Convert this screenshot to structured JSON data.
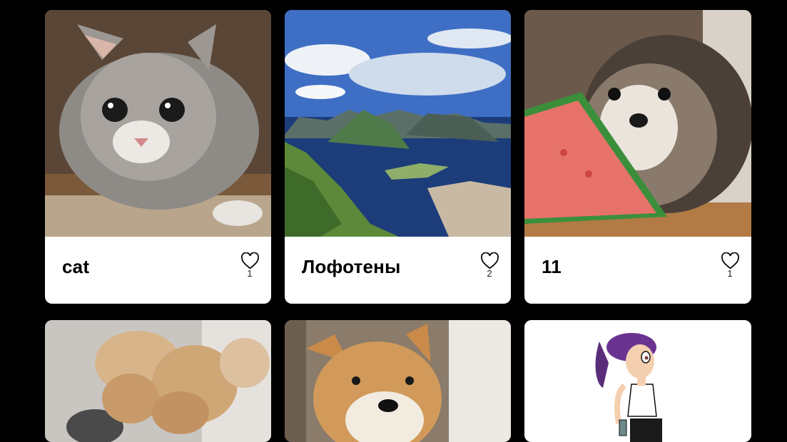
{
  "cards": [
    {
      "title": "cat",
      "likes": "1",
      "image": "cat-photo"
    },
    {
      "title": "Лофотены",
      "likes": "2",
      "image": "lofoten-landscape-photo"
    },
    {
      "title": "11",
      "likes": "1",
      "image": "hedgehog-watermelon-photo"
    },
    {
      "title": "",
      "likes": "",
      "image": "shiba-puppies-photo"
    },
    {
      "title": "",
      "likes": "",
      "image": "shiba-dog-photo"
    },
    {
      "title": "",
      "likes": "",
      "image": "futurama-leela-image"
    }
  ],
  "icons": {
    "like": "heart-icon"
  },
  "colors": {
    "page_bg": "#000000",
    "card_bg": "#ffffff",
    "text": "#000000"
  }
}
